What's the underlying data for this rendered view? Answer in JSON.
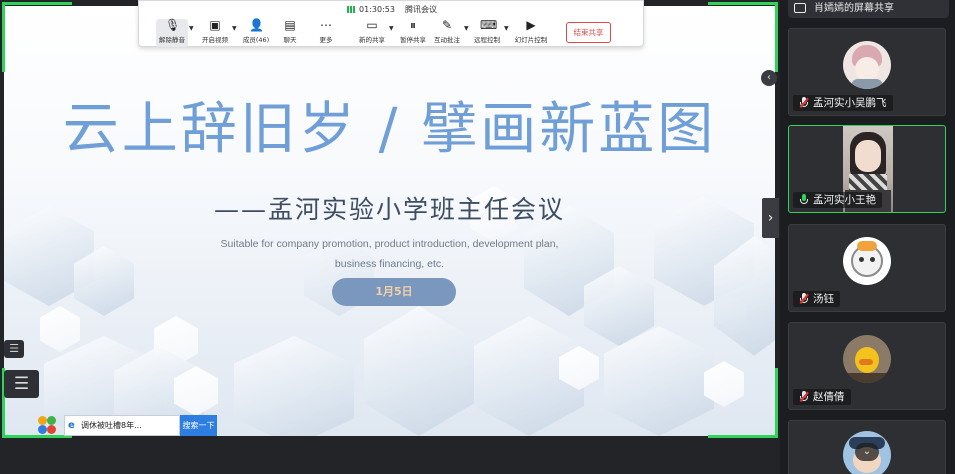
{
  "toolbar": {
    "time": "01:30:53",
    "app_name": "腾讯会议",
    "buttons": [
      {
        "id": "mute",
        "label": "解除静音",
        "icon": "mic-muted-icon"
      },
      {
        "id": "video",
        "label": "开启视频",
        "icon": "video-off-icon"
      },
      {
        "id": "members",
        "label": "成员(46)",
        "icon": "members-icon"
      },
      {
        "id": "chat",
        "label": "聊天",
        "icon": "chat-icon"
      },
      {
        "id": "more",
        "label": "更多",
        "icon": "more-icon"
      },
      {
        "id": "new_share",
        "label": "新的共享",
        "icon": "screen-share-icon"
      },
      {
        "id": "pause_share",
        "label": "暂停共享",
        "icon": "pause-icon"
      },
      {
        "id": "annotate",
        "label": "互动批注",
        "icon": "annotate-icon"
      },
      {
        "id": "remote",
        "label": "远程控制",
        "icon": "remote-control-icon"
      },
      {
        "id": "slides",
        "label": "幻灯片控制",
        "icon": "slideshow-icon"
      }
    ],
    "end_share": "结束共享"
  },
  "slide": {
    "title": "云上辞旧岁 / 擘画新蓝图",
    "subtitle": "——孟河实验小学班主任会议",
    "english": "Suitable for company promotion, product introduction, development plan, business financing, etc.",
    "date": "1月5日"
  },
  "taskbar": {
    "search_text": "调休被吐槽8年...",
    "search_button": "搜索一下"
  },
  "participants": {
    "sharing_label": "肖嫣嫣的屏幕共享",
    "tiles": [
      {
        "name": "孟河实小吴鹏飞",
        "mic": "muted",
        "kind": "avatar"
      },
      {
        "name": "孟河实小王艳",
        "mic": "on",
        "kind": "video"
      },
      {
        "name": "汤钰",
        "mic": "muted",
        "kind": "avatar"
      },
      {
        "name": "赵倩倩",
        "mic": "muted",
        "kind": "avatar"
      },
      {
        "name": "",
        "mic": "muted",
        "kind": "avatar"
      }
    ]
  },
  "colors": {
    "accent_green": "#2fd35a",
    "title_blue": "#6f9fd6",
    "end_red": "#e64545"
  }
}
